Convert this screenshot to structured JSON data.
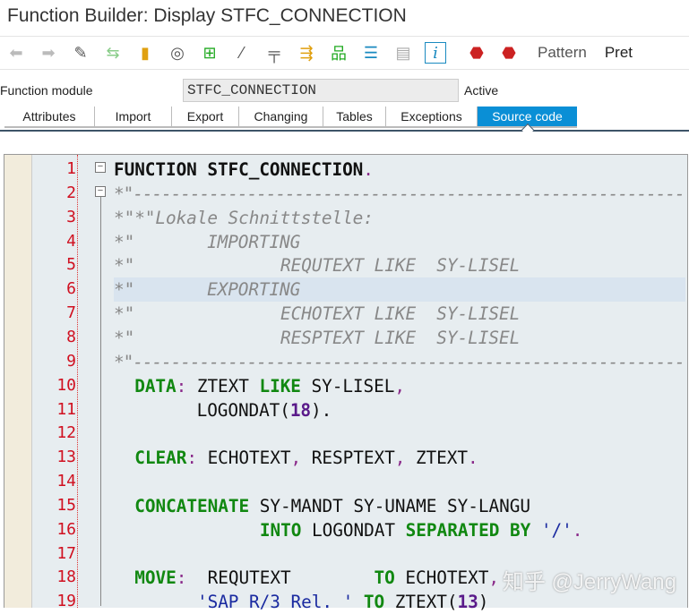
{
  "window": {
    "title": "Function Builder: Display STFC_CONNECTION"
  },
  "toolbar": {
    "icons": [
      "back-icon",
      "forward-icon",
      "display-change-icon",
      "active-inactive-icon",
      "activate-icon",
      "where-used-icon",
      "object-list-icon",
      "magic-wand-icon",
      "breakpoint-icon",
      "navigation-icon",
      "hierarchy-icon",
      "align-icon",
      "document-icon",
      "info-icon",
      "stop-icon",
      "stop-user-icon"
    ],
    "pattern_label": "Pattern",
    "pretty_label": "Pret"
  },
  "header": {
    "label": "Function module",
    "value": "STFC_CONNECTION",
    "status": "Active"
  },
  "tabs": [
    {
      "label": "Attributes"
    },
    {
      "label": "Import"
    },
    {
      "label": "Export"
    },
    {
      "label": "Changing"
    },
    {
      "label": "Tables"
    },
    {
      "label": "Exceptions"
    },
    {
      "label": "Source code",
      "active": true
    }
  ],
  "editor": {
    "highlighted_line": 6,
    "lines": [
      {
        "n": "1",
        "t": [
          [
            "FUNCTION STFC_CONNECTION",
            "fb"
          ],
          [
            ".",
            "pn"
          ]
        ]
      },
      {
        "n": "2",
        "t": [
          [
            "*\"----------------------------------------------------------",
            "cm"
          ]
        ]
      },
      {
        "n": "3",
        "t": [
          [
            "*\"*\"Lokale Schnittstelle:",
            "cm"
          ]
        ]
      },
      {
        "n": "4",
        "t": [
          [
            "*\"       IMPORTING",
            "cm"
          ]
        ]
      },
      {
        "n": "5",
        "t": [
          [
            "*\"              REQUTEXT LIKE  SY-LISEL",
            "cm"
          ]
        ]
      },
      {
        "n": "6",
        "t": [
          [
            "*\"       EXPORTING",
            "cm"
          ]
        ]
      },
      {
        "n": "7",
        "t": [
          [
            "*\"              ECHOTEXT LIKE  SY-LISEL",
            "cm"
          ]
        ]
      },
      {
        "n": "8",
        "t": [
          [
            "*\"              RESPTEXT LIKE  SY-LISEL",
            "cm"
          ]
        ]
      },
      {
        "n": "9",
        "t": [
          [
            "*\"----------------------------------------------------------",
            "cm"
          ]
        ]
      },
      {
        "n": "10",
        "t": [
          [
            "  ",
            ""
          ],
          [
            "DATA",
            "kw"
          ],
          [
            ":",
            "pn"
          ],
          [
            " ZTEXT ",
            ""
          ],
          [
            "LIKE",
            "kw"
          ],
          [
            " SY-LISEL",
            ""
          ],
          [
            ",",
            "pn"
          ]
        ]
      },
      {
        "n": "11",
        "t": [
          [
            "        LOGONDAT(",
            ""
          ],
          [
            "18",
            "num"
          ],
          [
            ").",
            ""
          ]
        ]
      },
      {
        "n": "12",
        "t": []
      },
      {
        "n": "13",
        "t": [
          [
            "  ",
            ""
          ],
          [
            "CLEAR",
            "kw"
          ],
          [
            ":",
            "pn"
          ],
          [
            " ECHOTEXT",
            ""
          ],
          [
            ",",
            "pn"
          ],
          [
            " RESPTEXT",
            ""
          ],
          [
            ",",
            "pn"
          ],
          [
            " ZTEXT",
            ""
          ],
          [
            ".",
            "pn"
          ]
        ]
      },
      {
        "n": "14",
        "t": []
      },
      {
        "n": "15",
        "t": [
          [
            "  ",
            ""
          ],
          [
            "CONCATENATE",
            "kw"
          ],
          [
            " SY-MANDT SY-UNAME SY-LANGU",
            ""
          ]
        ]
      },
      {
        "n": "16",
        "t": [
          [
            "              ",
            ""
          ],
          [
            "INTO",
            "kw"
          ],
          [
            " LOGONDAT ",
            ""
          ],
          [
            "SEPARATED BY",
            "kw"
          ],
          [
            " ",
            ""
          ],
          [
            "'/'",
            "str"
          ],
          [
            ".",
            "pn"
          ]
        ]
      },
      {
        "n": "17",
        "t": []
      },
      {
        "n": "18",
        "t": [
          [
            "  ",
            ""
          ],
          [
            "MOVE",
            "kw"
          ],
          [
            ":",
            "pn"
          ],
          [
            "  REQUTEXT        ",
            ""
          ],
          [
            "TO",
            "kw"
          ],
          [
            " ECHOTEXT",
            ""
          ],
          [
            ",",
            "pn"
          ]
        ]
      },
      {
        "n": "19",
        "t": [
          [
            "        ",
            ""
          ],
          [
            "'SAP R/3 Rel. '",
            "str"
          ],
          [
            " ",
            ""
          ],
          [
            "TO",
            "kw"
          ],
          [
            " ZTEXT(",
            ""
          ],
          [
            "13",
            "num"
          ],
          [
            ")",
            ""
          ]
        ]
      }
    ]
  },
  "watermark": "知乎 @JerryWang"
}
